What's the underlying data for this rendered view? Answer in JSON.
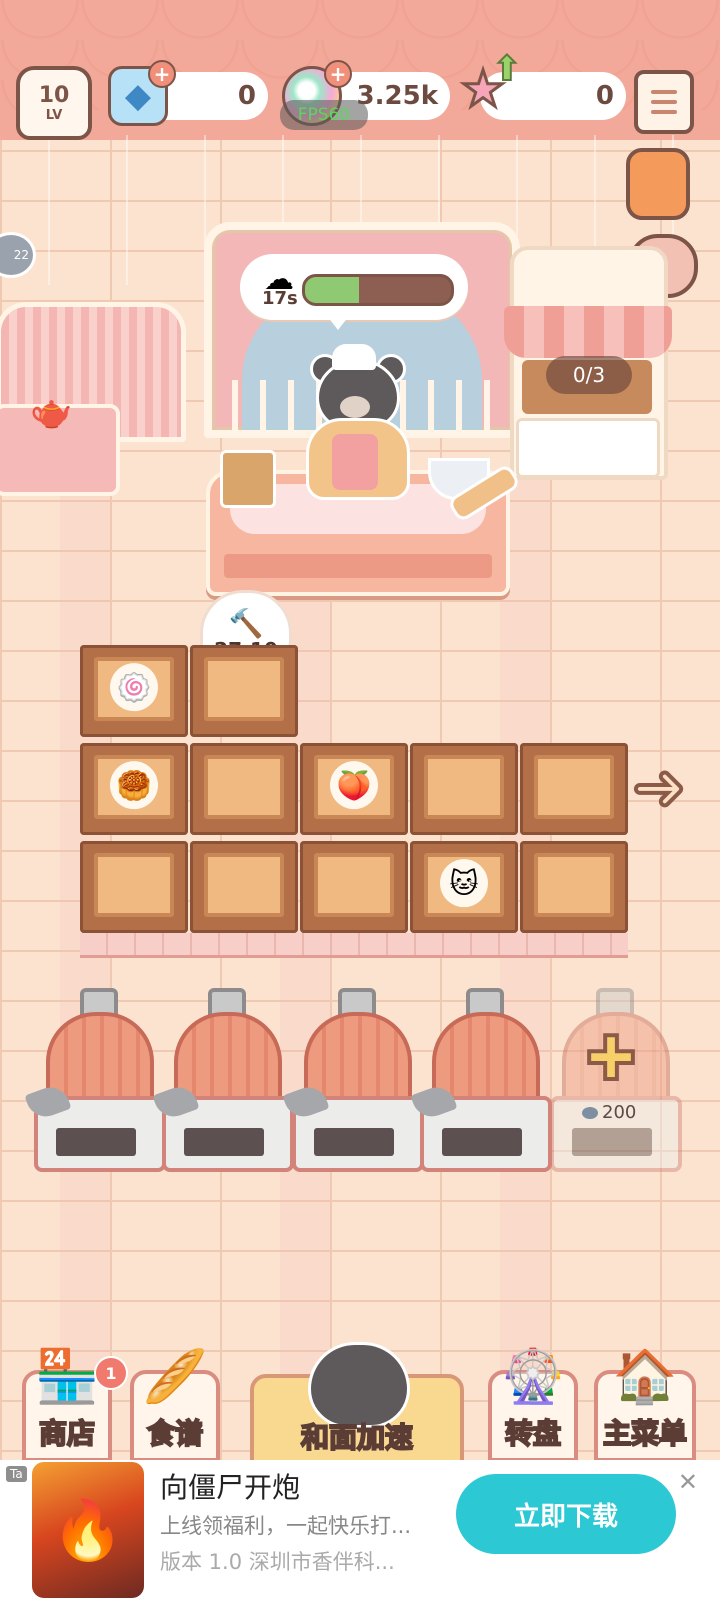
{
  "hud": {
    "level": "10",
    "level_unit": "LV",
    "gems": "0",
    "coins": "3.25k",
    "stars": "0",
    "fps": "FPS60"
  },
  "scene": {
    "kneading_timer": "17s",
    "kneading_progress": 0.37,
    "stand_count": "0/3",
    "build_timer": "27:10"
  },
  "grid": {
    "rows": [
      [
        "swiss-roll",
        "empty"
      ],
      [
        "tart",
        "empty",
        "peach-bun",
        "empty",
        "empty"
      ],
      [
        "empty",
        "empty",
        "empty",
        "cat-bread",
        "empty"
      ]
    ]
  },
  "ovens": {
    "unlock_cost": "200"
  },
  "nav": {
    "shop": "商店",
    "shop_badge": "1",
    "recipes": "食谱",
    "speed_up": "和面加速",
    "wheel": "转盘",
    "main_menu": "主菜单"
  },
  "ad": {
    "tag": "Ta",
    "title": "向僵尸开炮",
    "description": "上线领福利，一起快乐打...",
    "meta": "版本 1.0   深圳市香伴科...",
    "download": "立即下载",
    "close": "✕"
  },
  "colors": {
    "awning": "#f3a99a",
    "progress": "#8fca73",
    "ad_button": "#2cc8d3"
  }
}
